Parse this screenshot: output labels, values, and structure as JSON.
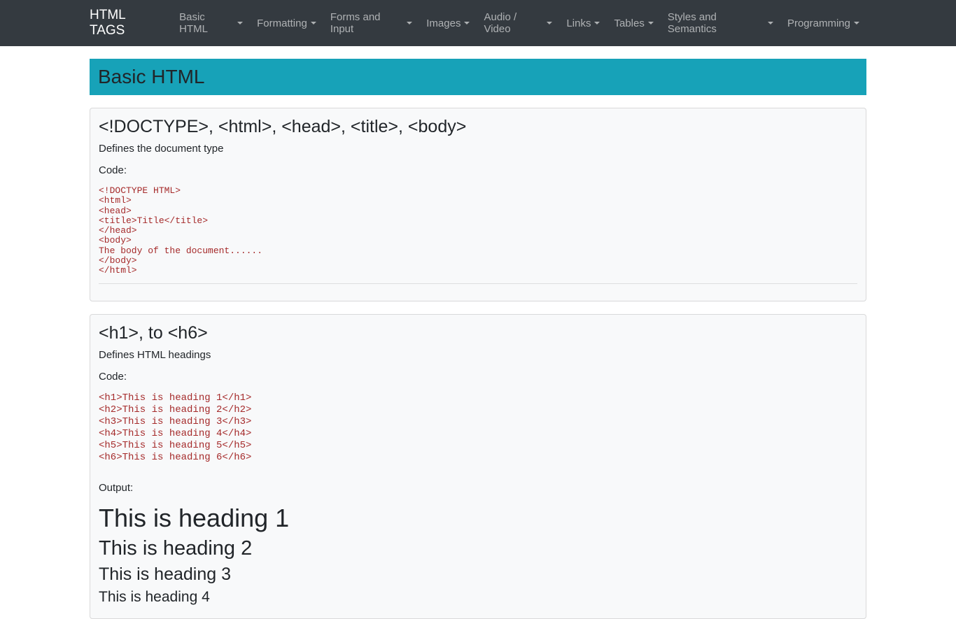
{
  "navbar": {
    "brand": "HTML TAGS",
    "items": [
      "Basic HTML",
      "Formatting",
      "Forms and Input",
      "Images",
      "Audio / Video",
      "Links",
      "Tables",
      "Styles and Semantics",
      "Programming"
    ]
  },
  "page_title": "Basic HTML",
  "card1": {
    "heading": "<!DOCTYPE>, <html>, <head>, <title>, <body>",
    "desc": "Defines the document type",
    "code_label": "Code:",
    "code": "<!DOCTYPE HTML>\n<html>\n<head>\n<title>Title</title>\n</head>\n<body>\nThe body of the document......\n</body>\n</html>"
  },
  "card2": {
    "heading": "<h1>, to <h6>",
    "desc": "Defines HTML headings",
    "code_label": "Code:",
    "code": "<h1>This is heading 1</h1>\n<h2>This is heading 2</h2>\n<h3>This is heading 3</h3>\n<h4>This is heading 4</h4>\n<h5>This is heading 5</h5>\n<h6>This is heading 6</h6>",
    "output_label": "Output:",
    "output": {
      "h1": "This is heading 1",
      "h2": "This is heading 2",
      "h3": "This is heading 3",
      "h4": "This is heading 4"
    }
  }
}
